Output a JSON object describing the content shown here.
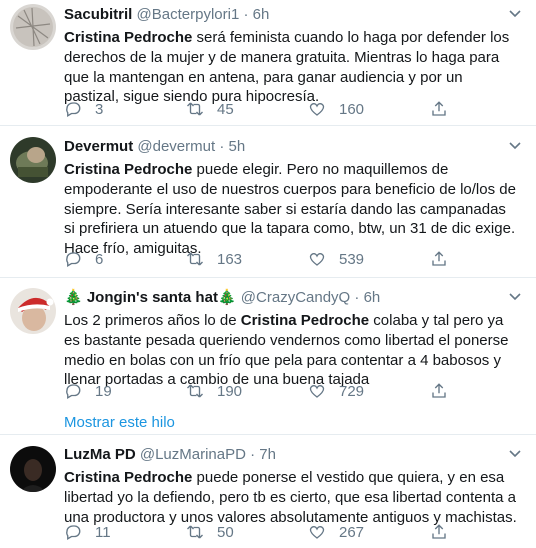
{
  "tweets": [
    {
      "name": "Sacubitril",
      "handle": "@Bacterpylori1",
      "dot": "·",
      "time": "6h",
      "mention": "Cristina Pedroche",
      "body_pre": "",
      "body_post": " será feminista cuando lo haga por defender los derechos de la mujer y de manera gratuita. Mientras lo haga para que la mantengan en antena, para ganar audiencia y por un pastizal, sigue siendo pura hipocresía.",
      "replies": "3",
      "retweets": "45",
      "likes": "160"
    },
    {
      "name": "Devermut",
      "handle": "@devermut",
      "dot": "·",
      "time": "5h",
      "mention": "Cristina Pedroche",
      "body_pre": "",
      "body_post": " puede elegir. Pero no maquillemos de empoderante el uso de nuestros cuerpos para beneficio de lo/los de siempre. Sería interesante saber si estaría dando las campanadas si prefiriera un atuendo que la tapara como, btw, un 31 de dic exige. Hace frío, amiguitas.",
      "replies": "6",
      "retweets": "163",
      "likes": "539"
    },
    {
      "name": "🎄 Jongin's santa hat🎄",
      "handle": "@CrazyCandyQ",
      "dot": "·",
      "time": "6h",
      "mention": "Cristina Pedroche",
      "body_pre": "Los 2 primeros años lo de ",
      "body_post": " colaba y tal pero ya es bastante pesada queriendo vendernos como libertad el ponerse medio en bolas con un frío que pela para contentar a 4 babosos y llenar portadas a cambio de una buena tajada",
      "replies": "19",
      "retweets": "190",
      "likes": "729",
      "thread_link": "Mostrar este hilo"
    },
    {
      "name": "LuzMa PD",
      "handle": "@LuzMarinaPD",
      "dot": "·",
      "time": "7h",
      "mention": "Cristina Pedroche",
      "body_pre": "",
      "body_post": " puede ponerse el vestido que quiera, y en esa libertad yo la defiendo, pero tb es cierto, que esa libertad contenta a una productora y unos valores absolutamente antiguos y machistas.",
      "replies": "11",
      "retweets": "50",
      "likes": "267"
    }
  ],
  "icons": {
    "reply": "reply-icon",
    "retweet": "retweet-icon",
    "like": "heart-icon",
    "share": "share-icon",
    "more": "chevron-down-icon"
  },
  "colors": {
    "text": "#14171a",
    "muted": "#657786",
    "link": "#1b95e0",
    "separator": "#e6ecf0"
  }
}
